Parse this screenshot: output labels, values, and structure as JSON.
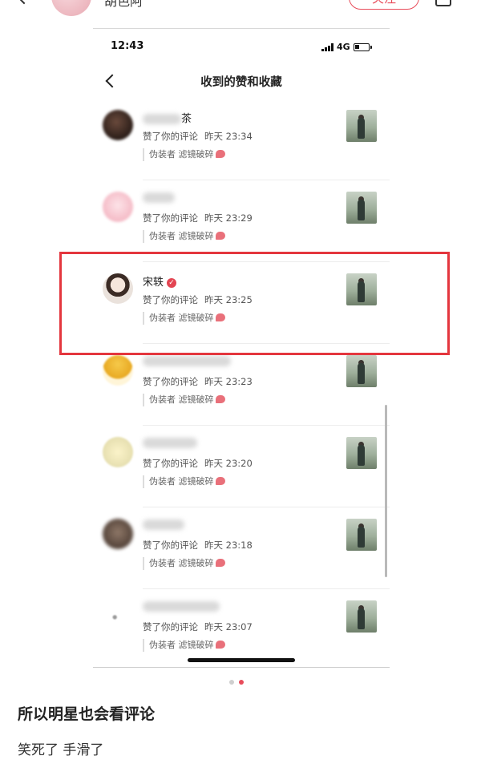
{
  "outer_header": {
    "author_name": "胡色阿",
    "follow_label": "关注"
  },
  "screenshot": {
    "status_bar": {
      "time": "12:43",
      "network": "4G"
    },
    "nav": {
      "title": "收到的赞和收藏"
    },
    "notifications": [
      {
        "name": "茶",
        "name_blurred": true,
        "action": "赞了你的评论",
        "time": "昨天 23:34",
        "quoted_user": "伪装者",
        "quoted_text": "滤镜破碎",
        "avatar": "avatar-photo-dark"
      },
      {
        "name": "",
        "name_blurred": true,
        "action": "赞了你的评论",
        "time": "昨天 23:29",
        "quoted_user": "伪装者",
        "quoted_text": "滤镜破碎",
        "avatar": "avatar-pink-cartoon"
      },
      {
        "name": "宋轶",
        "name_blurred": false,
        "verified": true,
        "action": "赞了你的评论",
        "time": "昨天 23:25",
        "quoted_user": "伪装者",
        "quoted_text": "滤镜破碎",
        "avatar": "avatar-woman-portrait"
      },
      {
        "name": "",
        "name_blurred": true,
        "action": "赞了你的评论",
        "time": "昨天 23:23",
        "quoted_user": "伪装者",
        "quoted_text": "滤镜破碎",
        "avatar": "avatar-yellow-badge"
      },
      {
        "name": "",
        "name_blurred": true,
        "action": "赞了你的评论",
        "time": "昨天 23:20",
        "quoted_user": "伪装者",
        "quoted_text": "滤镜破碎",
        "avatar": "avatar-lightbulb"
      },
      {
        "name": "",
        "name_blurred": true,
        "action": "赞了你的评论",
        "time": "昨天 23:18",
        "quoted_user": "伪装者",
        "quoted_text": "滤镜破碎",
        "avatar": "avatar-photo-brown"
      },
      {
        "name": "",
        "name_blurred": true,
        "action": "赞了你的评论",
        "time": "昨天 23:07",
        "quoted_user": "伪装者",
        "quoted_text": "滤镜破碎",
        "avatar": "avatar-small-figure"
      }
    ]
  },
  "carousel": {
    "count": 2,
    "active_index": 1
  },
  "post": {
    "title": "所以明星也会看评论",
    "body": "笑死了 手滑了"
  },
  "colors": {
    "accent": "#e84c5a",
    "highlight_box": "#e4363e"
  }
}
